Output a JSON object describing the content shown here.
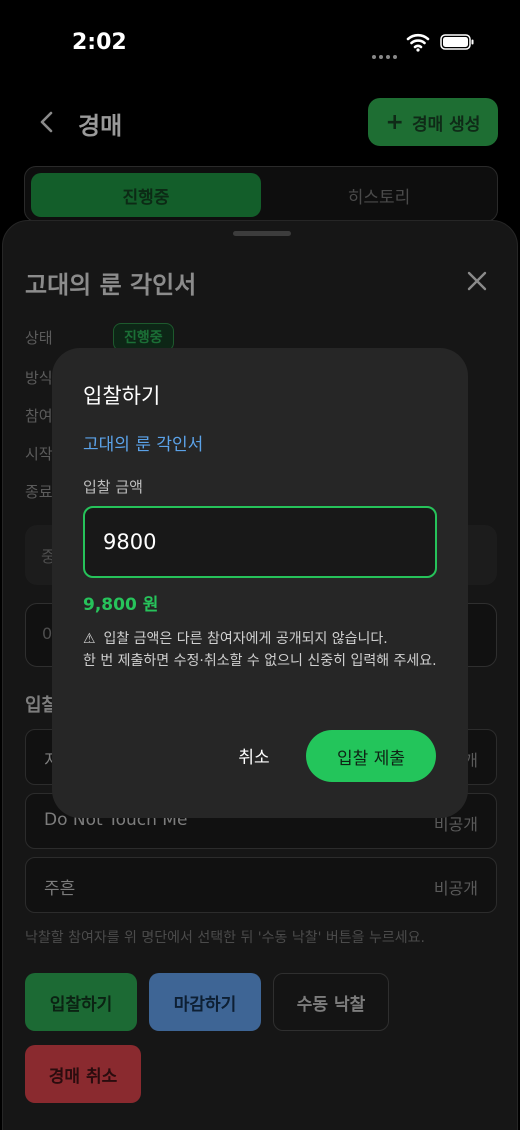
{
  "status_bar": {
    "time": "2:02"
  },
  "header": {
    "title": "경매",
    "create_button": "경매 생성",
    "create_icon": "plus-icon"
  },
  "tabs": [
    {
      "label": "진행중",
      "active": true
    },
    {
      "label": "히스토리",
      "active": false
    }
  ],
  "sheet": {
    "title": "고대의 룬 각인서",
    "status_label": "상태",
    "status_badge": "진행중",
    "truncated_labels": [
      "방식",
      "참여",
      "시작",
      "종료"
    ],
    "box1_text": "중",
    "box2_text": "0",
    "section_label": "입찰",
    "bidders": [
      {
        "name": "지",
        "visibility": "개"
      },
      {
        "name": "Do Not Touch Me",
        "visibility": "비공개"
      },
      {
        "name": "주흔",
        "visibility": "비공개"
      }
    ],
    "hint": "낙찰할 참여자를 위 명단에서 선택한 뒤 '수동 낙찰' 버튼을 누르세요.",
    "buttons": {
      "bid": "입찰하기",
      "close": "마감하기",
      "manual": "수동 낙찰",
      "cancel": "경매 취소"
    }
  },
  "dialog": {
    "title": "입찰하기",
    "item_name": "고대의 룬 각인서",
    "amount_label": "입찰 금액",
    "amount_value": "9800",
    "amount_formatted": "9,800 원",
    "warning_icon": "⚠",
    "warning_line1": "입찰 금액은 다른 참여자에게 공개되지 않습니다.",
    "warning_line2": "한 번 제출하면 수정·취소할 수 없으니 신중히 입력해 주세요.",
    "cancel": "취소",
    "submit": "입찰 제출"
  },
  "colors": {
    "accent_green": "#23c55b",
    "link_blue": "#5ba2e8",
    "dialog_bg": "#262626"
  }
}
